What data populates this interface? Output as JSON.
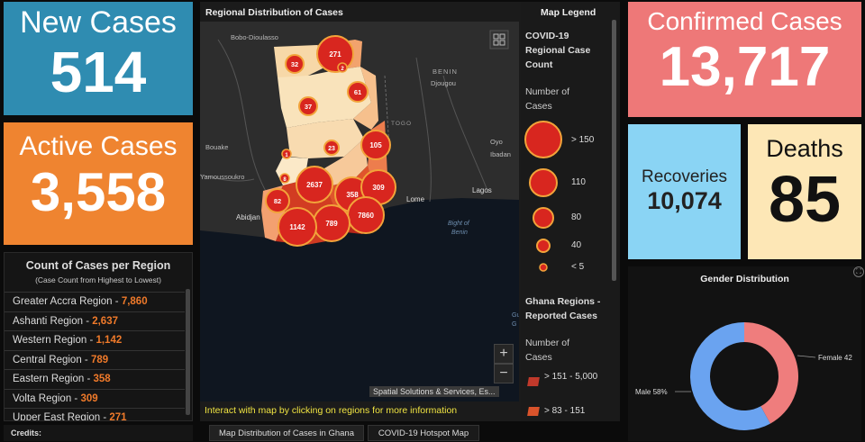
{
  "tiles": {
    "new_cases": {
      "title": "New Cases",
      "value": "514",
      "color": "#2f8cb1"
    },
    "active_cases": {
      "title": "Active Cases",
      "value": "3,558",
      "color": "#ef8430"
    },
    "confirmed_cases": {
      "title": "Confirmed Cases",
      "value": "13,717",
      "color": "#ee7878"
    },
    "recoveries": {
      "title": "Recoveries",
      "value": "10,074",
      "color": "#8ad4f4"
    },
    "deaths": {
      "title": "Deaths",
      "value": "85",
      "color": "#fde7b6"
    }
  },
  "region_list": {
    "title": "Count of Cases per Region",
    "subtitle": "(Case Count from Highest to Lowest)",
    "items": [
      {
        "label": "Greater Accra Region - ",
        "value": "7,860"
      },
      {
        "label": "Ashanti Region - ",
        "value": "2,637"
      },
      {
        "label": "Western Region - ",
        "value": "1,142"
      },
      {
        "label": "Central Region - ",
        "value": "789"
      },
      {
        "label": "Eastern Region - ",
        "value": "358"
      },
      {
        "label": "Volta Region - ",
        "value": "309"
      },
      {
        "label": "Upper East Region - ",
        "value": "271"
      }
    ]
  },
  "credits": {
    "label": "Credits:"
  },
  "map": {
    "title": "Regional Distribution of Cases",
    "hint": "Interact with map by clicking on regions for more information",
    "attribution": "Spatial Solutions & Services, Es...",
    "zoom_in": "+",
    "zoom_out": "−",
    "places": [
      "Bobo-Dioulasso",
      "BENIN",
      "Djougou",
      "TOGO",
      "Bouake",
      "Yamoussoukro",
      "Abidjan",
      "Lome",
      "Lagos",
      "Oyo",
      "Ibadan",
      "Bight of",
      "Benin",
      "Gu",
      "G"
    ],
    "clusters": [
      "271",
      "2",
      "32",
      "61",
      "37",
      "105",
      "23",
      "1",
      "2637",
      "8",
      "358",
      "309",
      "82",
      "7860",
      "789",
      "1142"
    ]
  },
  "legend": {
    "title": "Map Legend",
    "layer1_title": "COVID-19 Regional Case Count",
    "layer1_sub": "Number of Cases",
    "sizes": [
      {
        "label": "> 150"
      },
      {
        "label": "110"
      },
      {
        "label": "80"
      },
      {
        "label": "40"
      },
      {
        "label": "< 5"
      }
    ],
    "layer2_title": "Ghana Regions - Reported Cases",
    "layer2_sub": "Number of Cases",
    "classes": [
      {
        "label": "> 151 - 5,000",
        "color": "#c0392b"
      },
      {
        "label": "> 83 - 151",
        "color": "#d9532b"
      }
    ]
  },
  "tabs": [
    {
      "label": "Map Distribution of Cases in Ghana",
      "active": true
    },
    {
      "label": "COVID-19 Hotspot Map",
      "active": false
    }
  ],
  "gender": {
    "title": "Gender Distribution",
    "female_label": "Female 42",
    "male_label": "Male 58%",
    "female_value": 42,
    "male_value": 58,
    "female_color": "#ef7d7d",
    "male_color": "#6aa3f0"
  }
}
